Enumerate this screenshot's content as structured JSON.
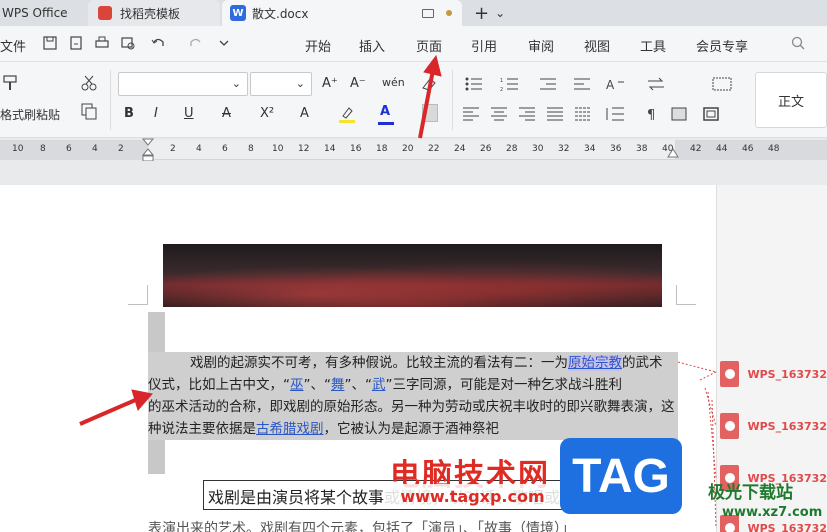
{
  "titlebar": {
    "app_tab": "WPS Office",
    "template_tab": "找稻壳模板",
    "doc_tab": "散文.docx",
    "plus": "+",
    "chevron": "⌄"
  },
  "menubar": {
    "file": "文件",
    "items": [
      "开始",
      "插入",
      "页面",
      "引用",
      "审阅",
      "视图",
      "工具",
      "会员专享"
    ],
    "active": "开始"
  },
  "ribbon": {
    "format_painter": "格式刷",
    "paste": "粘贴",
    "font_name": "",
    "font_size": "",
    "style_label": "正文",
    "buttons": [
      "A⁺",
      "A⁻",
      "wén",
      "B",
      "I",
      "U",
      "A",
      "X²",
      "A",
      "A"
    ]
  },
  "ruler": {
    "left_ticks": [
      "10",
      "8",
      "6",
      "4",
      "2"
    ],
    "right_ticks": [
      "2",
      "4",
      "6",
      "8",
      "10",
      "12",
      "14",
      "16",
      "18",
      "20",
      "22",
      "24",
      "26",
      "28",
      "30",
      "32",
      "34",
      "36",
      "38",
      "40",
      "42",
      "44",
      "46",
      "48"
    ]
  },
  "document": {
    "para_lines": [
      "戏剧的起源实不可考，有多种假说。比较主流的看法有二：一为",
      "仪式，比如上古中文，“",
      "的巫术活动的合称，即戏剧的原始形态。另一种为劳动或庆祝丰收时的即兴歌舞表演，这",
      "种说法主要依据是"
    ],
    "link_primitive": "原始宗教",
    "after_link": "的武术",
    "wu1": "巫",
    "sep1": "”、“",
    "wu2": "舞",
    "sep2": "”、“",
    "wu3": "武",
    "line2_rest": "”三字同源，可能是对一种乞求战斗胜利",
    "link_greek": "古希腊戏剧",
    "line4_rest": "，它被认为是起源于酒神祭祀",
    "heading": "戏剧是由演员将某个故事或情境，以对话、歌唱或动作等",
    "bottom_line": "表演出来的艺术。戏剧有四个元素，包括了「演员」、「故事（情境）」"
  },
  "comments": [
    "WPS_163732",
    "WPS_163732",
    "WPS_163732",
    "WPS_163732"
  ],
  "watermark": {
    "title": "电脑技术网",
    "url": "www.tagxp.com",
    "tag": "TAG",
    "site_logo": "极光下载站",
    "site_url": "www.xz7.com"
  }
}
